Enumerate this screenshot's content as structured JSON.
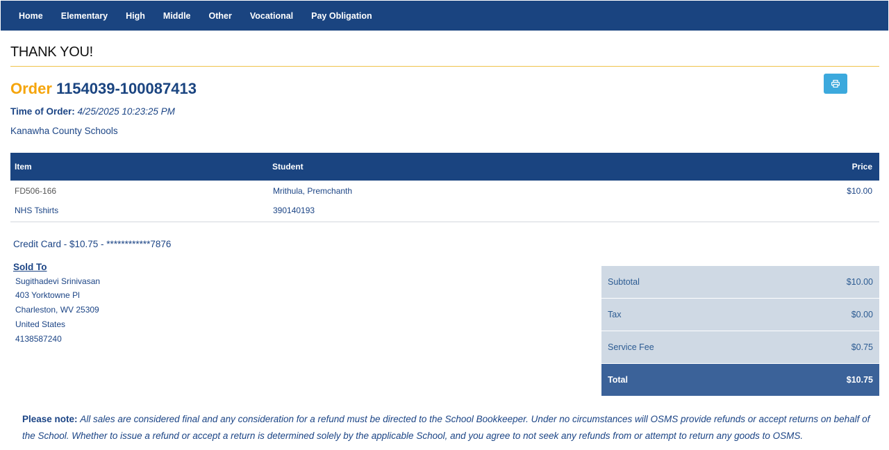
{
  "nav": {
    "items": [
      "Home",
      "Elementary",
      "High",
      "Middle",
      "Other",
      "Vocational",
      "Pay Obligation"
    ]
  },
  "page": {
    "heading": "THANK YOU!"
  },
  "order": {
    "label": "Order",
    "number": "1154039-100087413",
    "time_label": "Time of Order:",
    "time_value": "4/25/2025 10:23:25 PM",
    "district": "Kanawha County Schools"
  },
  "items_table": {
    "headers": {
      "item": "Item",
      "student": "Student",
      "price": "Price"
    },
    "rows": [
      {
        "item_code": "FD506-166",
        "item_name": "NHS Tshirts",
        "student_name": "Mrithula, Premchanth",
        "student_id": "390140193",
        "price": "$10.00"
      }
    ]
  },
  "payment": {
    "text": "Credit Card - $10.75 - ************7876"
  },
  "sold_to": {
    "title": "Sold To",
    "name": "Sugithadevi Srinivasan",
    "street": "403 Yorktowne Pl",
    "city_state_zip": "Charleston, WV 25309",
    "country": "United States",
    "phone": "4138587240"
  },
  "totals": {
    "subtotal_label": "Subtotal",
    "subtotal": "$10.00",
    "tax_label": "Tax",
    "tax": "$0.00",
    "fee_label": "Service Fee",
    "fee": "$0.75",
    "total_label": "Total",
    "total": "$10.75"
  },
  "note": {
    "label": "Please note:",
    "text": "All sales are considered final and any consideration for a refund must be directed to the School Bookkeeper. Under no circumstances will OSMS provide refunds or accept returns on behalf of the School. Whether to issue a refund or accept a return is determined solely by the applicable School, and you agree to not seek any refunds from or attempt to return any goods to OSMS."
  },
  "colors": {
    "nav_bg": "#1a4480",
    "accent_gold": "#f5a50c",
    "print_button": "#3ca9dd",
    "totals_row": "#cfd9e4",
    "total_row": "#3b6299"
  },
  "icons": {
    "print": "printer-icon"
  }
}
